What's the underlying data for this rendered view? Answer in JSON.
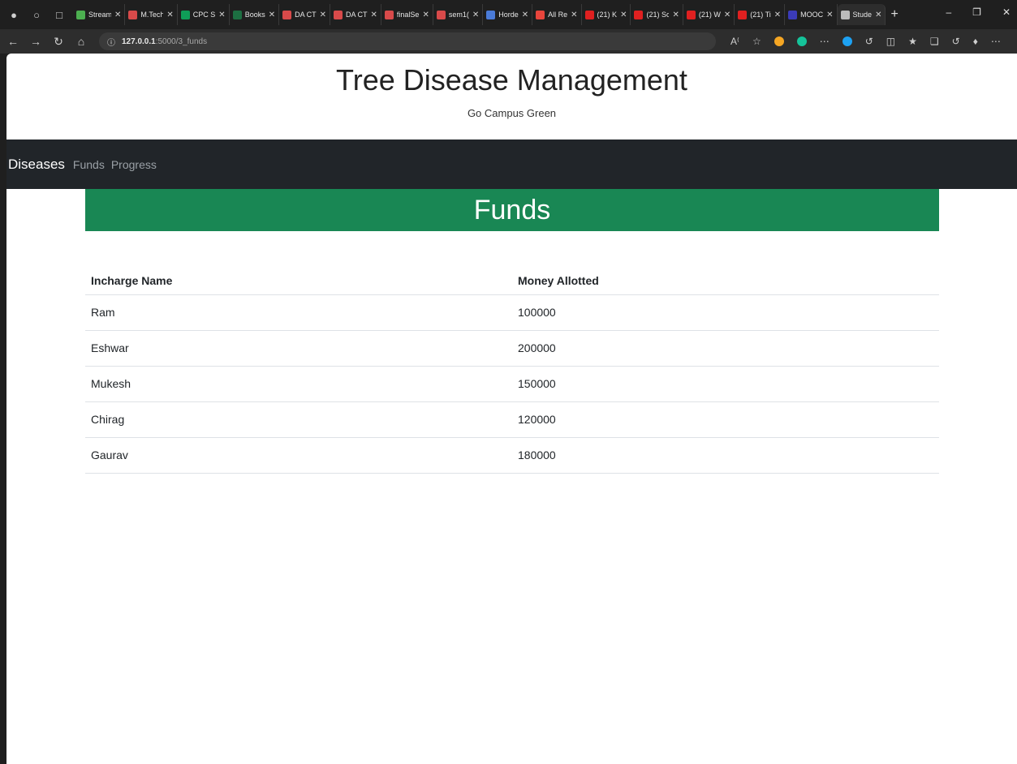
{
  "browser": {
    "tabs": [
      {
        "label": "Stream",
        "color": "#4caf50"
      },
      {
        "label": "M.Tech",
        "color": "#d84a4a"
      },
      {
        "label": "CPC S",
        "color": "#0f9d58"
      },
      {
        "label": "Books",
        "color": "#1d6f42"
      },
      {
        "label": "DA CT",
        "color": "#d84a4a"
      },
      {
        "label": "DA CT",
        "color": "#d84a4a"
      },
      {
        "label": "finalSe",
        "color": "#d84a4a"
      },
      {
        "label": "sem1(",
        "color": "#d84a4a"
      },
      {
        "label": "Horde",
        "color": "#4a7bd8"
      },
      {
        "label": "All Re",
        "color": "#e8453c"
      },
      {
        "label": "(21) K",
        "color": "#e02020"
      },
      {
        "label": "(21) Sc",
        "color": "#e02020"
      },
      {
        "label": "(21) W",
        "color": "#e02020"
      },
      {
        "label": "(21) Ti",
        "color": "#e02020"
      },
      {
        "label": "MOOC",
        "color": "#3b3bb8"
      },
      {
        "label": "Stude",
        "color": "#bbbbbb",
        "active": true
      }
    ],
    "url_host": "127.0.0.1",
    "url_path": ":5000/3_funds"
  },
  "header": {
    "title": "Tree Disease Management",
    "subtitle": "Go Campus Green"
  },
  "navbar": {
    "brand": "Diseases",
    "links": [
      "Funds",
      "Progress"
    ]
  },
  "banner": {
    "title": "Funds",
    "color": "#198754"
  },
  "table": {
    "headers": [
      "Incharge Name",
      "Money Allotted"
    ],
    "rows": [
      [
        "Ram",
        "100000"
      ],
      [
        "Eshwar",
        "200000"
      ],
      [
        "Mukesh",
        "150000"
      ],
      [
        "Chirag",
        "120000"
      ],
      [
        "Gaurav",
        "180000"
      ]
    ]
  }
}
